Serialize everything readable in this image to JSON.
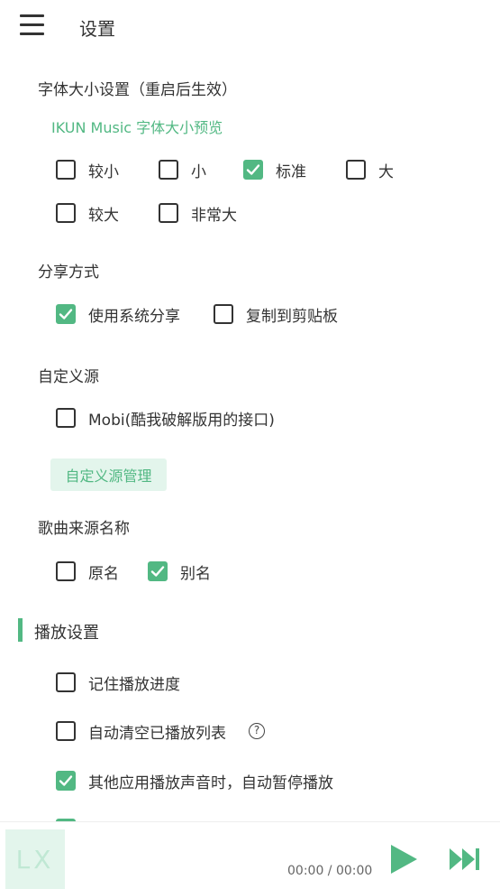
{
  "header": {
    "title": "设置"
  },
  "font_size": {
    "label": "字体大小设置（重启后生效）",
    "preview": "IKUN Music 字体大小预览",
    "options": [
      {
        "label": "较小",
        "checked": false
      },
      {
        "label": "小",
        "checked": false
      },
      {
        "label": "标准",
        "checked": true
      },
      {
        "label": "大",
        "checked": false
      },
      {
        "label": "较大",
        "checked": false
      },
      {
        "label": "非常大",
        "checked": false
      }
    ]
  },
  "share": {
    "label": "分享方式",
    "options": [
      {
        "label": "使用系统分享",
        "checked": true
      },
      {
        "label": "复制到剪贴板",
        "checked": false
      }
    ]
  },
  "custom_source": {
    "label": "自定义源",
    "options": [
      {
        "label": "Mobi(酷我破解版用的接口)",
        "checked": false
      }
    ],
    "manage_button": "自定义源管理"
  },
  "song_source_name": {
    "label": "歌曲来源名称",
    "options": [
      {
        "label": "原名",
        "checked": false
      },
      {
        "label": "别名",
        "checked": true
      }
    ]
  },
  "playback": {
    "title": "播放设置",
    "options": [
      {
        "label": "记住播放进度",
        "checked": false
      },
      {
        "label": "自动清空已播放列表",
        "checked": false
      },
      {
        "label": "其他应用播放声音时，自动暂停播放",
        "checked": true
      },
      {
        "label": "",
        "checked": true
      }
    ],
    "help_symbol": "?"
  },
  "player": {
    "cover_text": "LX",
    "time": "00:00 / 00:00"
  },
  "colors": {
    "accent": "#52b883",
    "accent_light": "#e3f5ec",
    "text": "#333333"
  }
}
